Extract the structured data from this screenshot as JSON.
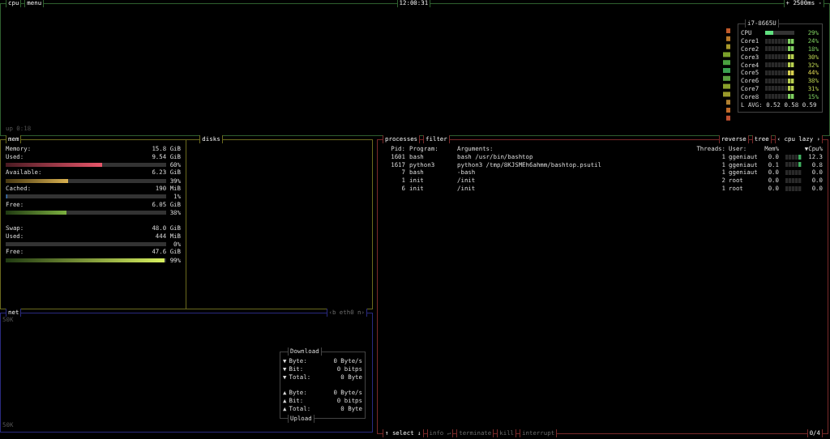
{
  "top_bar": {
    "tabs": [
      "cpu",
      "menu"
    ],
    "clock": "12:00:31",
    "interval_up": "+",
    "interval": "2500ms",
    "interval_down": "-"
  },
  "cpu": {
    "uptime": "up 0:18",
    "model": "i7-8665U",
    "total": {
      "label": "CPU",
      "level": 0.29,
      "percent": "29%"
    },
    "cores": [
      {
        "name": "Core1",
        "percent": "24%"
      },
      {
        "name": "Core2",
        "percent": "18%"
      },
      {
        "name": "Core3",
        "percent": "30%"
      },
      {
        "name": "Core4",
        "percent": "32%"
      },
      {
        "name": "Core5",
        "percent": "44%"
      },
      {
        "name": "Core6",
        "percent": "38%"
      },
      {
        "name": "Core7",
        "percent": "31%"
      },
      {
        "name": "Core8",
        "percent": "15%"
      }
    ],
    "load_avg": "L AVG: 0.52 0.58 0.59"
  },
  "mem": {
    "title": "mem",
    "memory": {
      "label": "Memory:",
      "value": "15.8 GiB"
    },
    "items": [
      {
        "label": "Used:",
        "value": "9.54 GiB",
        "level": 0.6,
        "percent": "60%"
      },
      {
        "label": "Available:",
        "value": "6.23 GiB",
        "level": 0.39,
        "percent": "39%"
      },
      {
        "label": "Cached:",
        "value": "190 MiB",
        "level": 0.01,
        "percent": "1%"
      },
      {
        "label": "Free:",
        "value": "6.05 GiB",
        "level": 0.38,
        "percent": "38%"
      }
    ],
    "swap": {
      "label": "Swap:",
      "value": "48.0 GiB"
    },
    "swap_items": [
      {
        "label": "Used:",
        "value": "444 MiB",
        "percent": "0%"
      },
      {
        "label": "Free:",
        "value": "47.6 GiB",
        "level": 0.99,
        "percent": "99%"
      }
    ]
  },
  "disks": {
    "title": "disks"
  },
  "net": {
    "title": "net",
    "interface": "‹b eth0 n›",
    "scale_top": "50K",
    "scale_bottom": "50K",
    "download_title": "Download",
    "upload_title": "Upload",
    "download": [
      {
        "arrow": "▼",
        "label": "Byte:",
        "value": "0 Byte/s"
      },
      {
        "arrow": "▼",
        "label": "Bit:",
        "value": "0 bitps"
      },
      {
        "arrow": "▼",
        "label": "Total:",
        "value": "0 Byte"
      }
    ],
    "upload": [
      {
        "arrow": "▲",
        "label": "Byte:",
        "value": "0 Byte/s"
      },
      {
        "arrow": "▲",
        "label": "Bit:",
        "value": "0 bitps"
      },
      {
        "arrow": "▲",
        "label": "Total:",
        "value": "0 Byte"
      }
    ]
  },
  "processes": {
    "title": "processes",
    "filter": "filter",
    "options": [
      "reverse",
      "tree",
      "‹ cpu lazy ›"
    ],
    "columns": [
      "Pid:",
      "Program:",
      "Arguments:",
      "Threads:",
      "User:",
      "Mem%",
      "▼Cpu%"
    ],
    "rows": [
      {
        "pid": "1601",
        "program": "bash",
        "args": "bash /usr/bin/bashtop",
        "threads": "1",
        "user": "ggeniaut",
        "mem": "0.0",
        "cpu": "12.3"
      },
      {
        "pid": "1617",
        "program": "python3",
        "args": "python3 /tmp/8KJSMEh6ahmm/bashtop.psutil",
        "threads": "1",
        "user": "ggeniaut",
        "mem": "0.1",
        "cpu": "0.8"
      },
      {
        "pid": "7",
        "program": "bash",
        "args": "-bash",
        "threads": "1",
        "user": "ggeniaut",
        "mem": "0.0",
        "cpu": "0.0"
      },
      {
        "pid": "1",
        "program": "init",
        "args": "/init",
        "threads": "2",
        "user": "root",
        "mem": "0.0",
        "cpu": "0.0"
      },
      {
        "pid": "6",
        "program": "init",
        "args": "/init",
        "threads": "1",
        "user": "root",
        "mem": "0.0",
        "cpu": "0.0"
      }
    ],
    "footer": [
      {
        "label": "↑ select ↓",
        "disabled": false
      },
      {
        "label": "info ↵",
        "disabled": true
      },
      {
        "label": "terminate",
        "disabled": true
      },
      {
        "label": "kill",
        "disabled": true
      },
      {
        "label": "interrupt",
        "disabled": true
      }
    ],
    "count": "0/4"
  }
}
